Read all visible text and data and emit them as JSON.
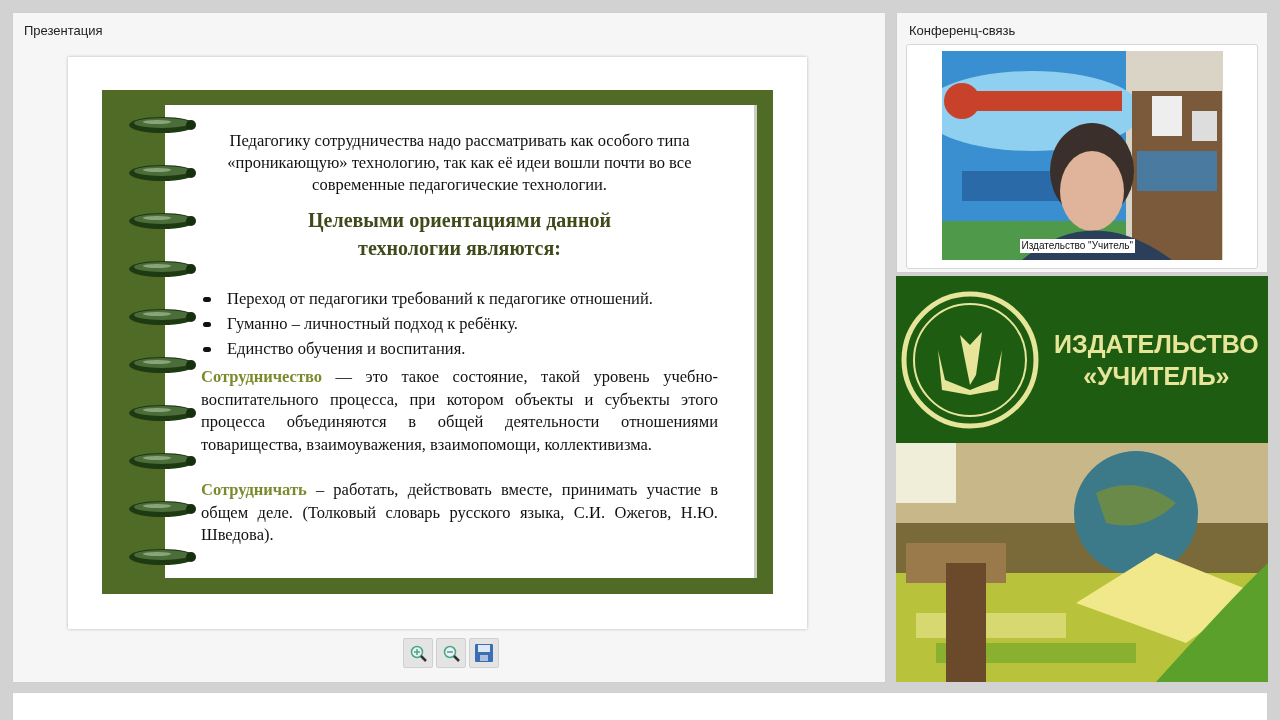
{
  "presentation_panel": {
    "title": "Презентация",
    "slide": {
      "intro": "Педагогику сотрудничества надо рассматривать как особого типа «проникающую» технологию, так как её идеи вошли почти во все современные педагогические технологии.",
      "heading": "Целевыми ориентациями данной технологии являются:",
      "bullets": [
        "Переход от педагогики требований к педагогике отношений.",
        "Гуманно – личностный подход к ребёнку.",
        "Единство обучения и воспитания."
      ],
      "paragraphs": [
        "**Сотрудничество** — это такое состояние, такой уровень учебно-воспитательного процесса, при котором объекты и субъекты этого процесса объединяются в общей деятельности отношениями товарищества, взаимоуважения, взаимопомощи, коллективизма.",
        "**Сотрудничать** – работать, действовать вместе, принимать участие в общем деле. (Толковый словарь русского языка, С.И. Ожегов, Н.Ю. Шведова)."
      ]
    },
    "toolbar": [
      {
        "kind": "zoom_in"
      },
      {
        "kind": "zoom_out"
      },
      {
        "kind": "save"
      }
    ]
  },
  "conference_panel": {
    "title": "Конференц-связь",
    "video": {
      "kind": "picture",
      "caption": "Издательство \"Учитель\""
    }
  },
  "publisher_banner": {
    "lines": [
      "ИЗДАТЕЛЬСТВО",
      "«УЧИТЕЛЬ»"
    ]
  }
}
